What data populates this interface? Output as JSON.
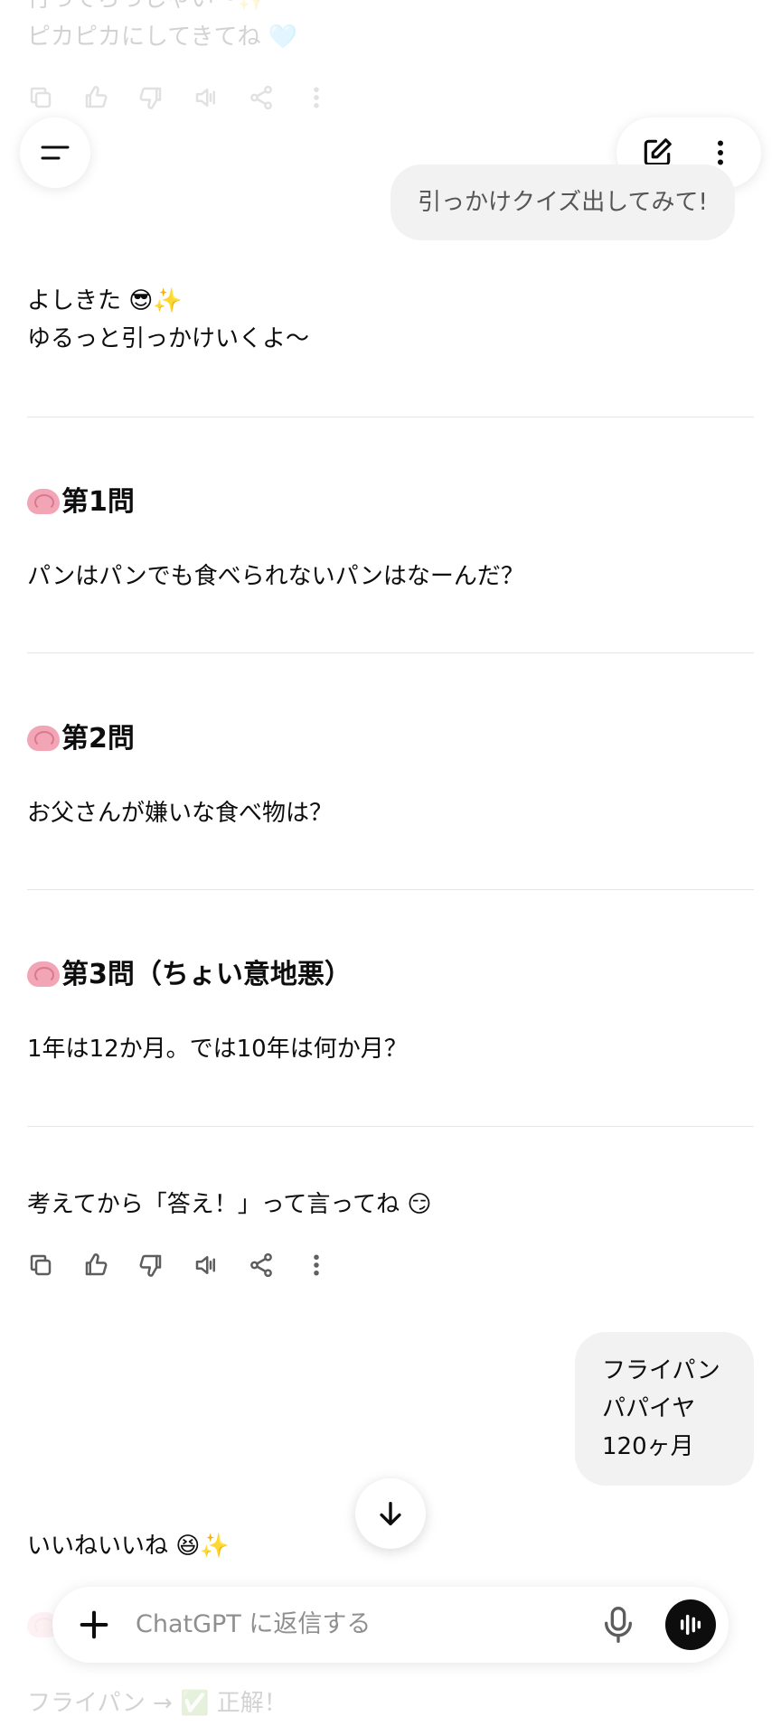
{
  "top_faded": {
    "line1": "行ってらっしゃい〜✨",
    "line2": "ピカピカにしてきてね 🩵"
  },
  "header": {
    "menu_icon": "menu-icon",
    "new_chat_icon": "edit-icon",
    "more_icon": "more-vertical-icon"
  },
  "messages": {
    "user1": "引っかけクイズ出してみて!",
    "assistant_intro_1": "よしきた 😎✨",
    "assistant_intro_2": "ゆるっと引っかけいくよ〜",
    "q1_title": "第1問",
    "q1_text": "パンはパンでも食べられないパンはなーんだ？",
    "q2_title": "第2問",
    "q2_text": "お父さんが嫌いな食べ物は？",
    "q3_title": "第3問（ちょい意地悪）",
    "q3_text": "1年は12か月。では10年は何か月？",
    "outro": "考えてから「答え！」って言ってね 😏",
    "user2_line1": "フライパン",
    "user2_line2": "パパイヤ",
    "user2_line3": "120ヶ月",
    "assistant_reply": "いいねいいね 😆✨",
    "faded_bottom": "フライパン → ✅ 正解！"
  },
  "composer": {
    "placeholder": "ChatGPT に返信する"
  },
  "action_icons": [
    "copy-icon",
    "thumbs-up-icon",
    "thumbs-down-icon",
    "speaker-icon",
    "share-icon",
    "more-icon"
  ]
}
